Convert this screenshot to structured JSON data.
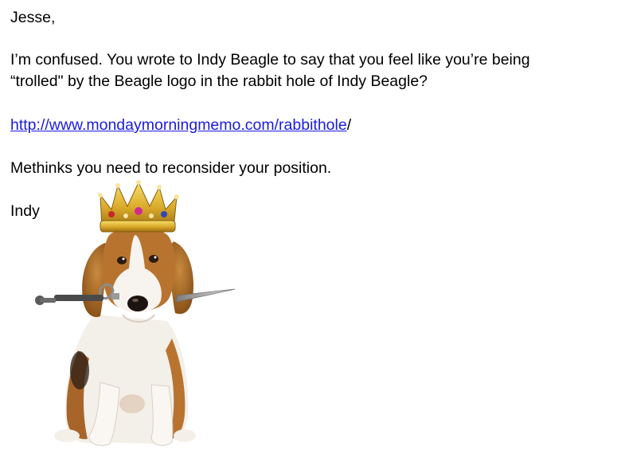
{
  "email": {
    "greeting": "Jesse,",
    "body_line_1": "I’m confused.  You wrote to Indy Beagle to say that you feel like you’re being",
    "body_line_2": "“trolled\" by the Beagle logo in the rabbit hole of Indy Beagle?",
    "link_text": "http://www.mondaymorningmemo.com/rabbithole",
    "link_suffix": "/",
    "closing": "Methinks you need to reconsider your position.",
    "signature": "Indy"
  },
  "colors": {
    "text": "#000000",
    "link": "#1a1ae0",
    "background": "#ffffff"
  },
  "image": {
    "subject": "beagle-wearing-crown-with-sword-in-mouth"
  }
}
